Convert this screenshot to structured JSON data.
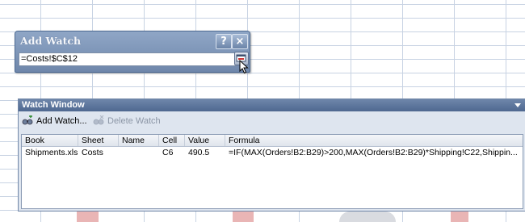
{
  "add_watch": {
    "title": "Add Watch",
    "help_label": "?",
    "close_label": "×",
    "reference_value": "=Costs!$C$12"
  },
  "watch_window": {
    "title": "Watch Window",
    "toolbar": {
      "add_label": "Add Watch...",
      "delete_label": "Delete Watch"
    },
    "columns": [
      "Book",
      "Sheet",
      "Name",
      "Cell",
      "Value",
      "Formula"
    ],
    "rows": [
      {
        "book": "Shipments.xls",
        "sheet": "Costs",
        "name": "",
        "cell": "C6",
        "value": "490.5",
        "formula": "=IF(MAX(Orders!B2:B29)>200,MAX(Orders!B2:B29)*Shipping!C22,Shippin..."
      }
    ]
  },
  "colors": {
    "dialog_title_bg": "#7b93b6",
    "watch_title_bg": "#5a7398",
    "panel_bg": "#dee5ef",
    "gridline": "#c8d3e3"
  }
}
